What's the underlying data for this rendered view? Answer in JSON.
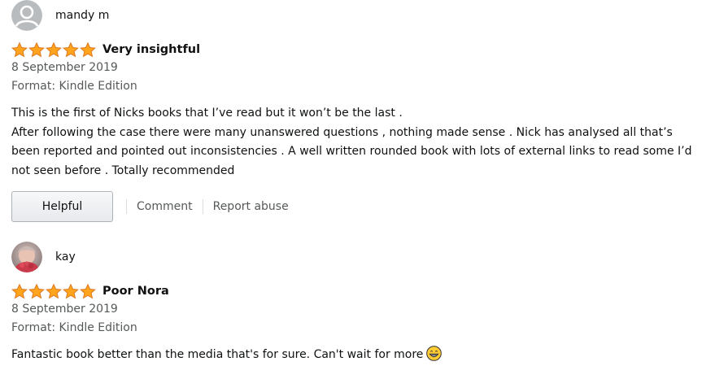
{
  "reviews": [
    {
      "reviewer": "mandy m",
      "avatar": "default-avatar-icon",
      "rating": 5,
      "title": "Very insightful",
      "date": "8 September 2019",
      "format": "Format: Kindle Edition",
      "body": [
        "This is the first of Nicks books that I’ve read but it won’t be the last .",
        "After following the case there were many unanswered questions , nothing made sense . Nick has analysed all that’s been reported and pointed out inconsistencies . A well written rounded book with lots of external links to read some I’d not seen before . Totally recommended"
      ],
      "helpful_label": "Helpful",
      "comment_label": "Comment",
      "report_label": "Report abuse"
    },
    {
      "reviewer": "kay",
      "avatar": "user-photo-avatar",
      "rating": 5,
      "title": "Poor Nora",
      "date": "8 September 2019",
      "format": "Format: Kindle Edition",
      "body": [
        "Fantastic book better than the media that's for sure. Can't wait for more"
      ],
      "emoji": "grinning-face-icon"
    }
  ],
  "colors": {
    "star_fill": "#ffa41c",
    "star_stroke": "#de7921",
    "muted_text": "#565959",
    "button_border": "#adb1b8"
  }
}
